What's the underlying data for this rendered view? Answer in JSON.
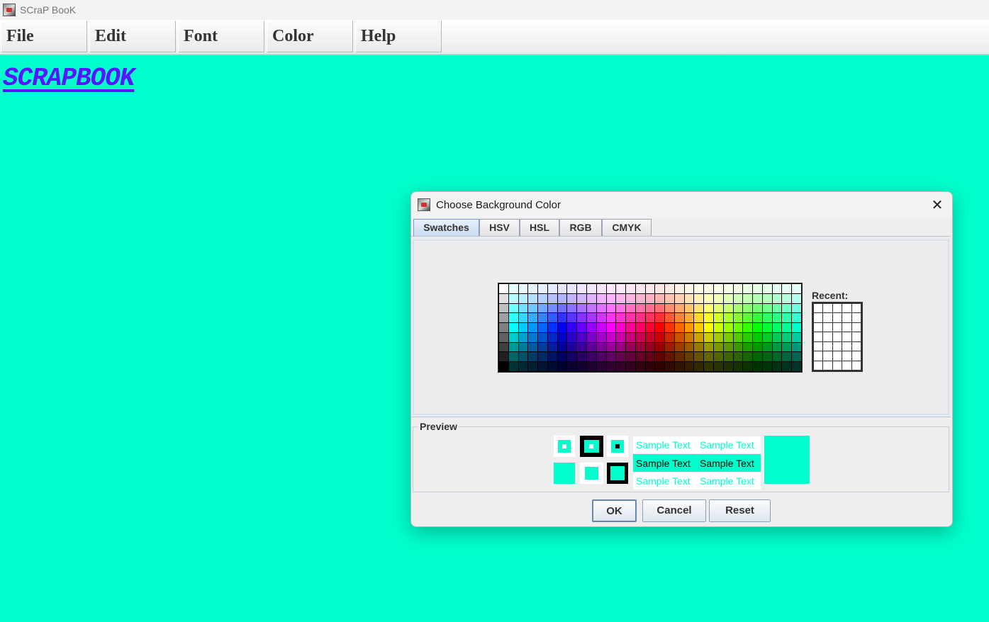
{
  "window": {
    "title": "SCraP BooK",
    "icon": "app-icon"
  },
  "menu": [
    {
      "label": "File"
    },
    {
      "label": "Edit"
    },
    {
      "label": "Font"
    },
    {
      "label": "Color"
    },
    {
      "label": "Help"
    }
  ],
  "page": {
    "heading": "SCRAPBOOK",
    "background": "#00ffcc",
    "heading_color": "#5b14ff"
  },
  "dialog": {
    "title": "Choose Background Color",
    "tabs": [
      {
        "label": "Swatches",
        "active": true
      },
      {
        "label": "HSV"
      },
      {
        "label": "HSL"
      },
      {
        "label": "RGB"
      },
      {
        "label": "CMYK"
      }
    ],
    "recent_label": "Recent:",
    "preview_label": "Preview",
    "sample_text": "Sample Text",
    "selected_color": "#00ffcc",
    "buttons": {
      "ok": "OK",
      "cancel": "Cancel",
      "reset": "Reset"
    }
  }
}
